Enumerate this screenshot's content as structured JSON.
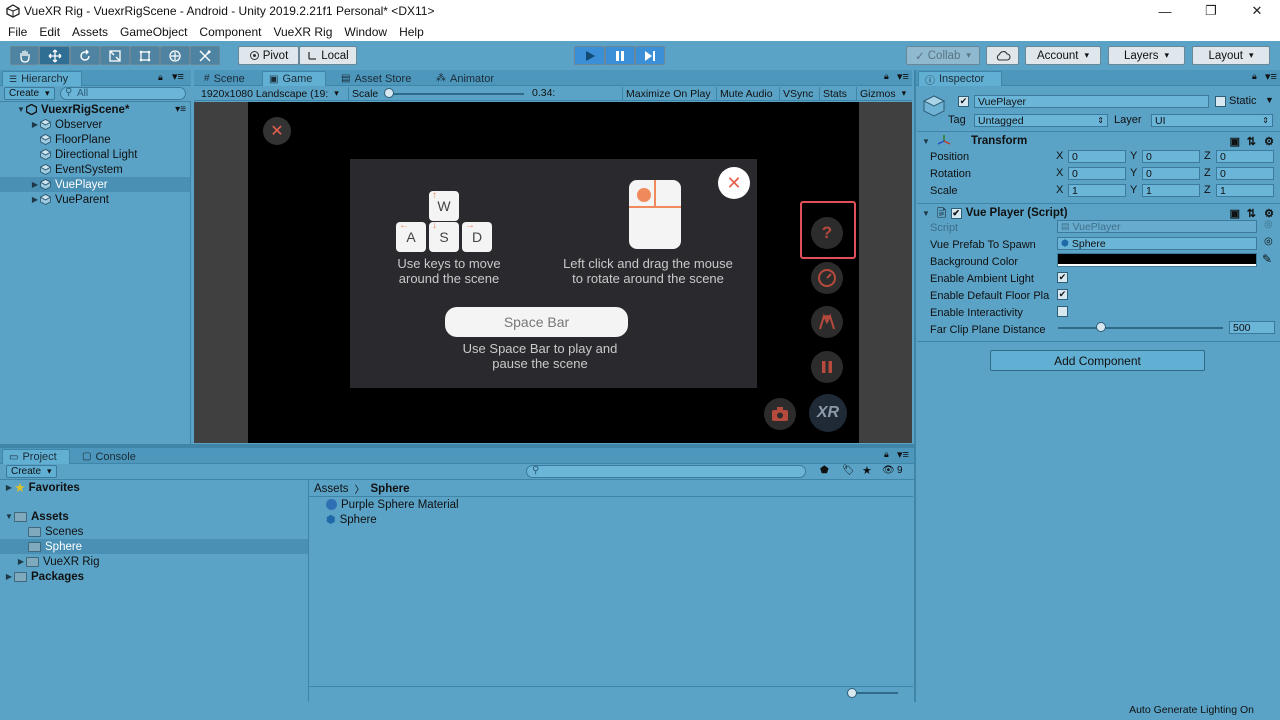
{
  "window": {
    "title": "VueXR Rig - VuexrRigScene - Android - Unity 2019.2.21f1 Personal* <DX11>",
    "controls": [
      "—",
      "❐",
      "✕"
    ]
  },
  "menu": [
    "File",
    "Edit",
    "Assets",
    "GameObject",
    "Component",
    "VueXR Rig",
    "Window",
    "Help"
  ],
  "toolbar": {
    "pivot_label": "Pivot",
    "local_label": "Local",
    "collab_label": "Collab",
    "account_label": "Account",
    "layers_label": "Layers",
    "layout_label": "Layout"
  },
  "hierarchy": {
    "tab_label": "Hierarchy",
    "create_label": "Create",
    "search_placeholder": "All",
    "scene_name": "VuexrRigScene*",
    "items": [
      {
        "label": "Observer",
        "expandable": true,
        "selected": false
      },
      {
        "label": "FloorPlane",
        "expandable": false,
        "selected": false
      },
      {
        "label": "Directional Light",
        "expandable": false,
        "selected": false
      },
      {
        "label": "EventSystem",
        "expandable": false,
        "selected": false
      },
      {
        "label": "VuePlayer",
        "expandable": true,
        "selected": true
      },
      {
        "label": "VueParent",
        "expandable": true,
        "selected": false
      }
    ]
  },
  "center_tabs": [
    "Scene",
    "Game",
    "Asset Store",
    "Animator"
  ],
  "game_toolbar": {
    "resolution": "1920x1080 Landscape (19:",
    "scale_label": "Scale",
    "scale_value": "0.34:",
    "buttons": [
      "Maximize On Play",
      "Mute Audio",
      "VSync",
      "Stats",
      "Gizmos"
    ]
  },
  "game_overlay": {
    "keys": [
      "W",
      "A",
      "S",
      "D"
    ],
    "keys_caption_1": "Use keys to move",
    "keys_caption_2": "around the scene",
    "mouse_caption_1": "Left click and drag the mouse",
    "mouse_caption_2": "to rotate around the scene",
    "space_label": "Space Bar",
    "space_caption_1": "Use Space Bar to play and",
    "space_caption_2": "pause the scene",
    "xr_logo": "XR"
  },
  "inspector": {
    "tab_label": "Inspector",
    "object_name": "VuePlayer",
    "static_label": "Static",
    "tag_label": "Tag",
    "tag_value": "Untagged",
    "layer_label": "Layer",
    "layer_value": "UI",
    "transform": {
      "title": "Transform",
      "rows": [
        {
          "label": "Position",
          "x": "0",
          "y": "0",
          "z": "0"
        },
        {
          "label": "Rotation",
          "x": "0",
          "y": "0",
          "z": "0"
        },
        {
          "label": "Scale",
          "x": "1",
          "y": "1",
          "z": "1"
        }
      ],
      "axes": [
        "X",
        "Y",
        "Z"
      ]
    },
    "script_component": {
      "title": "Vue Player (Script)",
      "script_label": "Script",
      "script_value": "VuePlayer",
      "prefab_label": "Vue Prefab To Spawn",
      "prefab_value": "Sphere",
      "bg_label": "Background Color",
      "bg_color": "#000000",
      "ambient_label": "Enable Ambient Light",
      "ambient_checked": true,
      "floor_label": "Enable Default Floor Pla",
      "floor_checked": true,
      "interactivity_label": "Enable Interactivity",
      "interactivity_checked": false,
      "farclip_label": "Far Clip Plane Distance",
      "farclip_value": "500",
      "farclip_fraction": 0.26
    },
    "add_component_label": "Add Component"
  },
  "project": {
    "tab_label": "Project",
    "console_tab_label": "Console",
    "create_label": "Create",
    "hidden_count": "9",
    "tree": [
      {
        "label": "Favorites",
        "bold": true,
        "level": 0
      },
      {
        "label": "Assets",
        "bold": true,
        "level": 0
      },
      {
        "label": "Scenes",
        "bold": false,
        "level": 1
      },
      {
        "label": "Sphere",
        "bold": false,
        "level": 1
      },
      {
        "label": "VueXR Rig",
        "bold": false,
        "level": 1
      },
      {
        "label": "Packages",
        "bold": true,
        "level": 0
      }
    ],
    "breadcrumb": [
      "Assets",
      "Sphere"
    ],
    "files": [
      "Purple Sphere Material",
      "Sphere"
    ]
  },
  "status": {
    "text": "Auto Generate Lighting On"
  },
  "colors": {
    "editor_bg": "#5aa3c6",
    "selection": "#4a8fb4",
    "accent_play": "#3a8fd6",
    "highlight_box": "#e0505a",
    "orange": "#f08a5d"
  }
}
